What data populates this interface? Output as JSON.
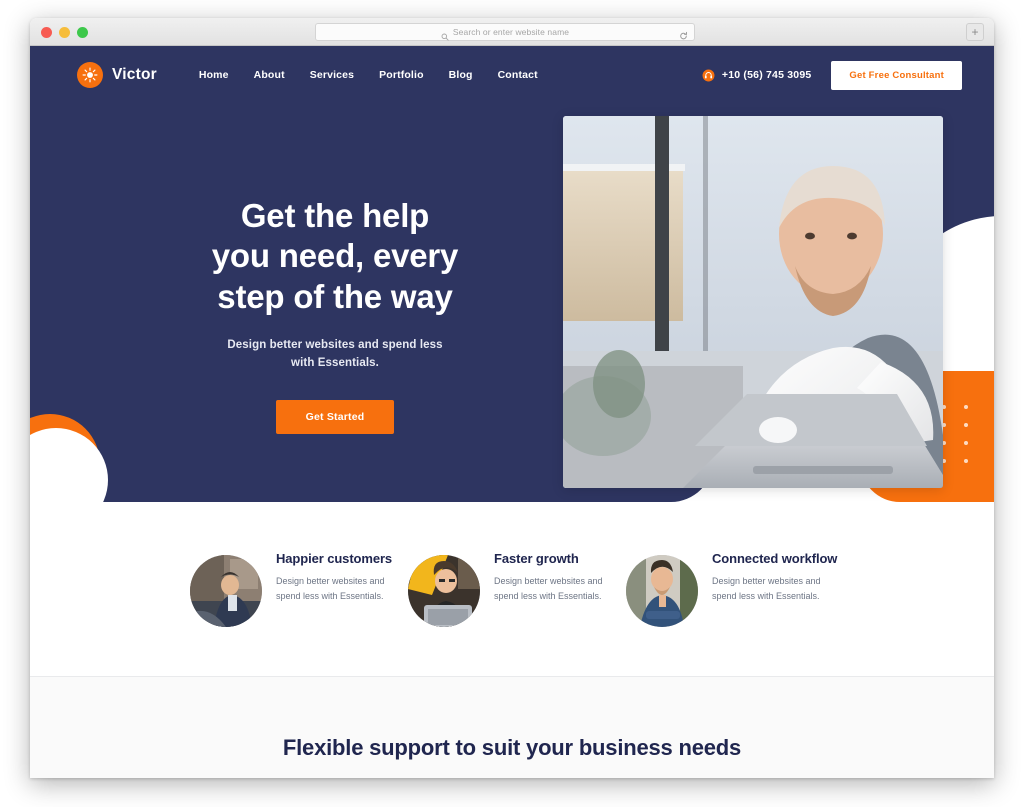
{
  "browser": {
    "url_placeholder": "Search or enter website name",
    "search_icon": "search-icon",
    "reload_icon": "reload-icon",
    "new_tab_label": "+",
    "traffic_lights": [
      "close",
      "minimize",
      "maximize"
    ]
  },
  "site": {
    "brand": {
      "name": "Victor",
      "icon": "sun-burst-icon",
      "mark_color": "#f7700e"
    },
    "nav": [
      {
        "label": "Home"
      },
      {
        "label": "About"
      },
      {
        "label": "Services"
      },
      {
        "label": "Portfolio"
      },
      {
        "label": "Blog"
      },
      {
        "label": "Contact"
      }
    ],
    "phone": {
      "number": "+10 (56) 745 3095",
      "icon": "headset-icon"
    },
    "consult_button": "Get Free Consultant"
  },
  "hero": {
    "title_line1": "Get the help",
    "title_line2": "you need, every",
    "title_line3": "step of the way",
    "subtitle_line1": "Design better websites and spend less",
    "subtitle_line2": "with Essentials.",
    "cta": "Get Started",
    "photo_alt": "man working on laptop by window"
  },
  "features": [
    {
      "title": "Happier customers",
      "desc": "Design better websites and spend less with Essentials.",
      "avatar_alt": "man seated on couch"
    },
    {
      "title": "Faster growth",
      "desc": "Design better websites and spend less with Essentials.",
      "avatar_alt": "woman smiling with laptop"
    },
    {
      "title": "Connected workflow",
      "desc": "Design better websites and spend less with Essentials.",
      "avatar_alt": "man with arms crossed"
    }
  ],
  "bottom": {
    "title": "Flexible support to suit your business needs"
  },
  "colors": {
    "navy": "#2e3561",
    "orange": "#f7700e",
    "heading": "#20264f",
    "body_text": "#6d7585",
    "white": "#ffffff"
  }
}
